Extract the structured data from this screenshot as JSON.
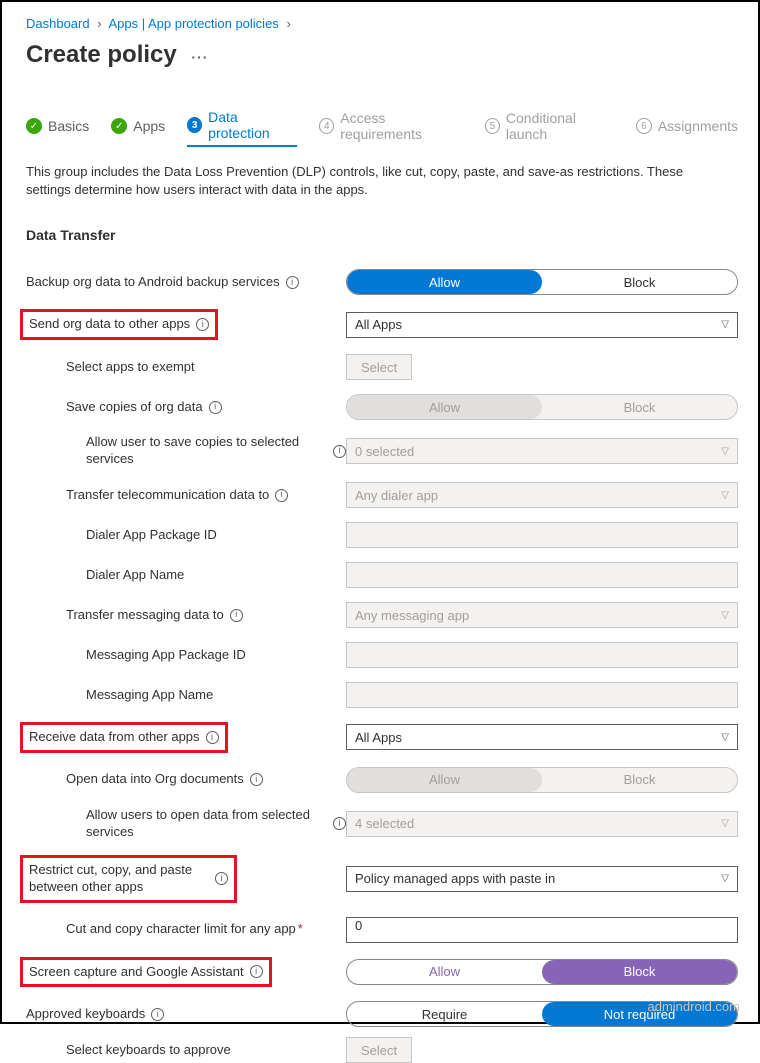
{
  "breadcrumb": {
    "dashboard": "Dashboard",
    "apps": "Apps | App protection policies"
  },
  "title": "Create policy",
  "tabs": {
    "basics": "Basics",
    "apps": "Apps",
    "data_protection": "Data protection",
    "num3": "3",
    "access": "Access requirements",
    "num4": "4",
    "conditional": "Conditional launch",
    "num5": "5",
    "assignments": "Assignments",
    "num6": "6"
  },
  "desc": "This group includes the Data Loss Prevention (DLP) controls, like cut, copy, paste, and save-as restrictions. These settings determine how users interact with data in the apps.",
  "section": "Data Transfer",
  "labels": {
    "backup": "Backup org data to Android backup services",
    "send": "Send org data to other apps",
    "select_exempt": "Select apps to exempt",
    "save_copies": "Save copies of org data",
    "allow_save_selected": "Allow user to save copies to selected services",
    "telecom": "Transfer telecommunication data to",
    "dialer_pkg": "Dialer App Package ID",
    "dialer_name": "Dialer App Name",
    "messaging": "Transfer messaging data to",
    "msg_pkg": "Messaging App Package ID",
    "msg_name": "Messaging App Name",
    "receive": "Receive data from other apps",
    "open_org": "Open data into Org documents",
    "open_selected": "Allow users to open data from selected services",
    "restrict": "Restrict cut, copy, and paste between other apps",
    "cut_limit": "Cut and copy character limit for any app",
    "screen_cap": "Screen capture and Google Assistant",
    "approved_kb": "Approved keyboards",
    "select_kb": "Select keyboards to approve"
  },
  "opts": {
    "allow": "Allow",
    "block": "Block",
    "require": "Require",
    "not_required": "Not required",
    "select": "Select",
    "all_apps": "All Apps",
    "zero_selected": "0 selected",
    "any_dialer": "Any dialer app",
    "any_messaging": "Any messaging app",
    "four_selected": "4 selected",
    "policy_paste": "Policy managed apps with paste in",
    "zero": "0"
  },
  "watermark": "admindroid.com"
}
